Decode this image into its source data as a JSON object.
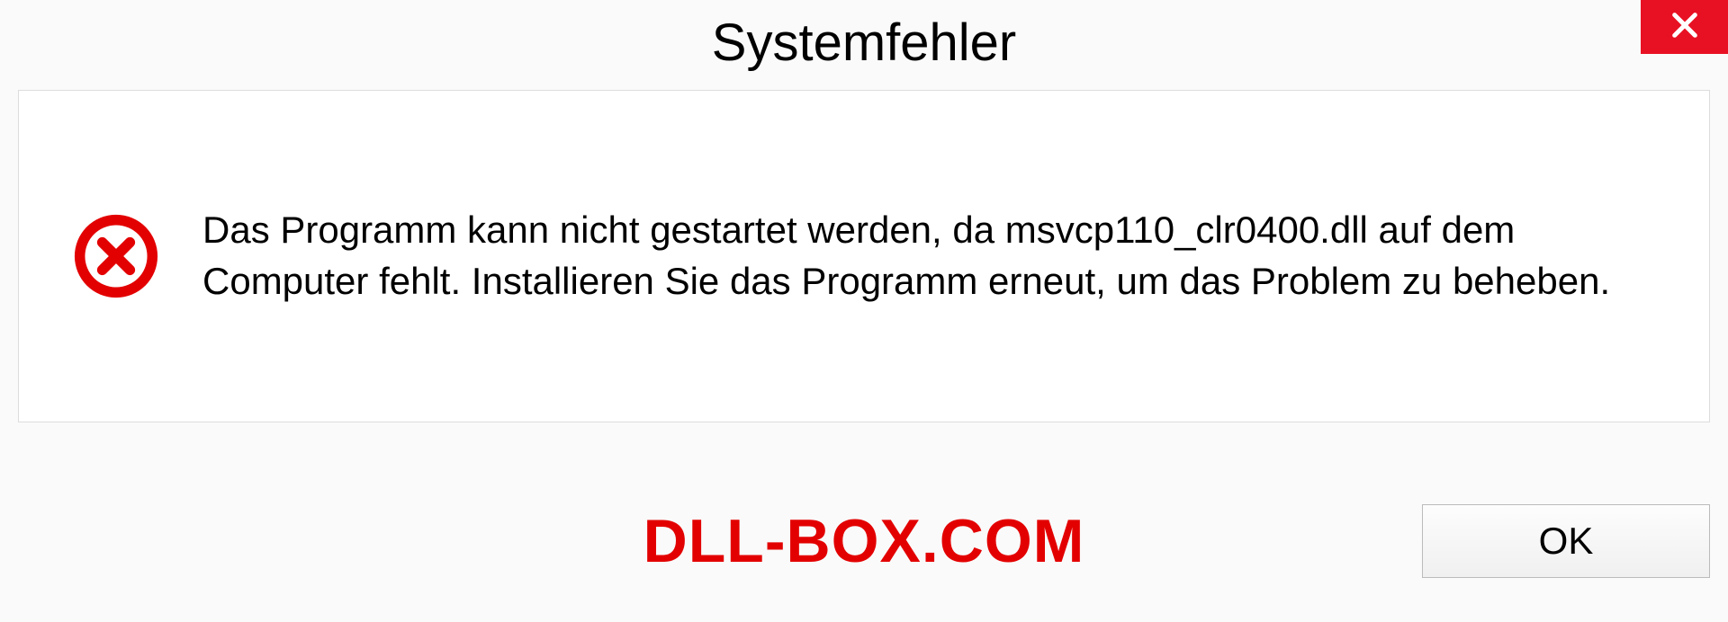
{
  "dialog": {
    "title": "Systemfehler",
    "message": "Das Programm kann nicht gestartet werden, da msvcp110_clr0400.dll auf dem Computer fehlt. Installieren Sie das Programm erneut, um das Problem zu beheben.",
    "ok_label": "OK"
  },
  "watermark": {
    "text": "DLL-BOX.COM"
  },
  "colors": {
    "close_bg": "#e81123",
    "error_red": "#e30000",
    "watermark_red": "#e30000"
  },
  "icons": {
    "close": "close-icon",
    "error": "error-circle-icon"
  }
}
